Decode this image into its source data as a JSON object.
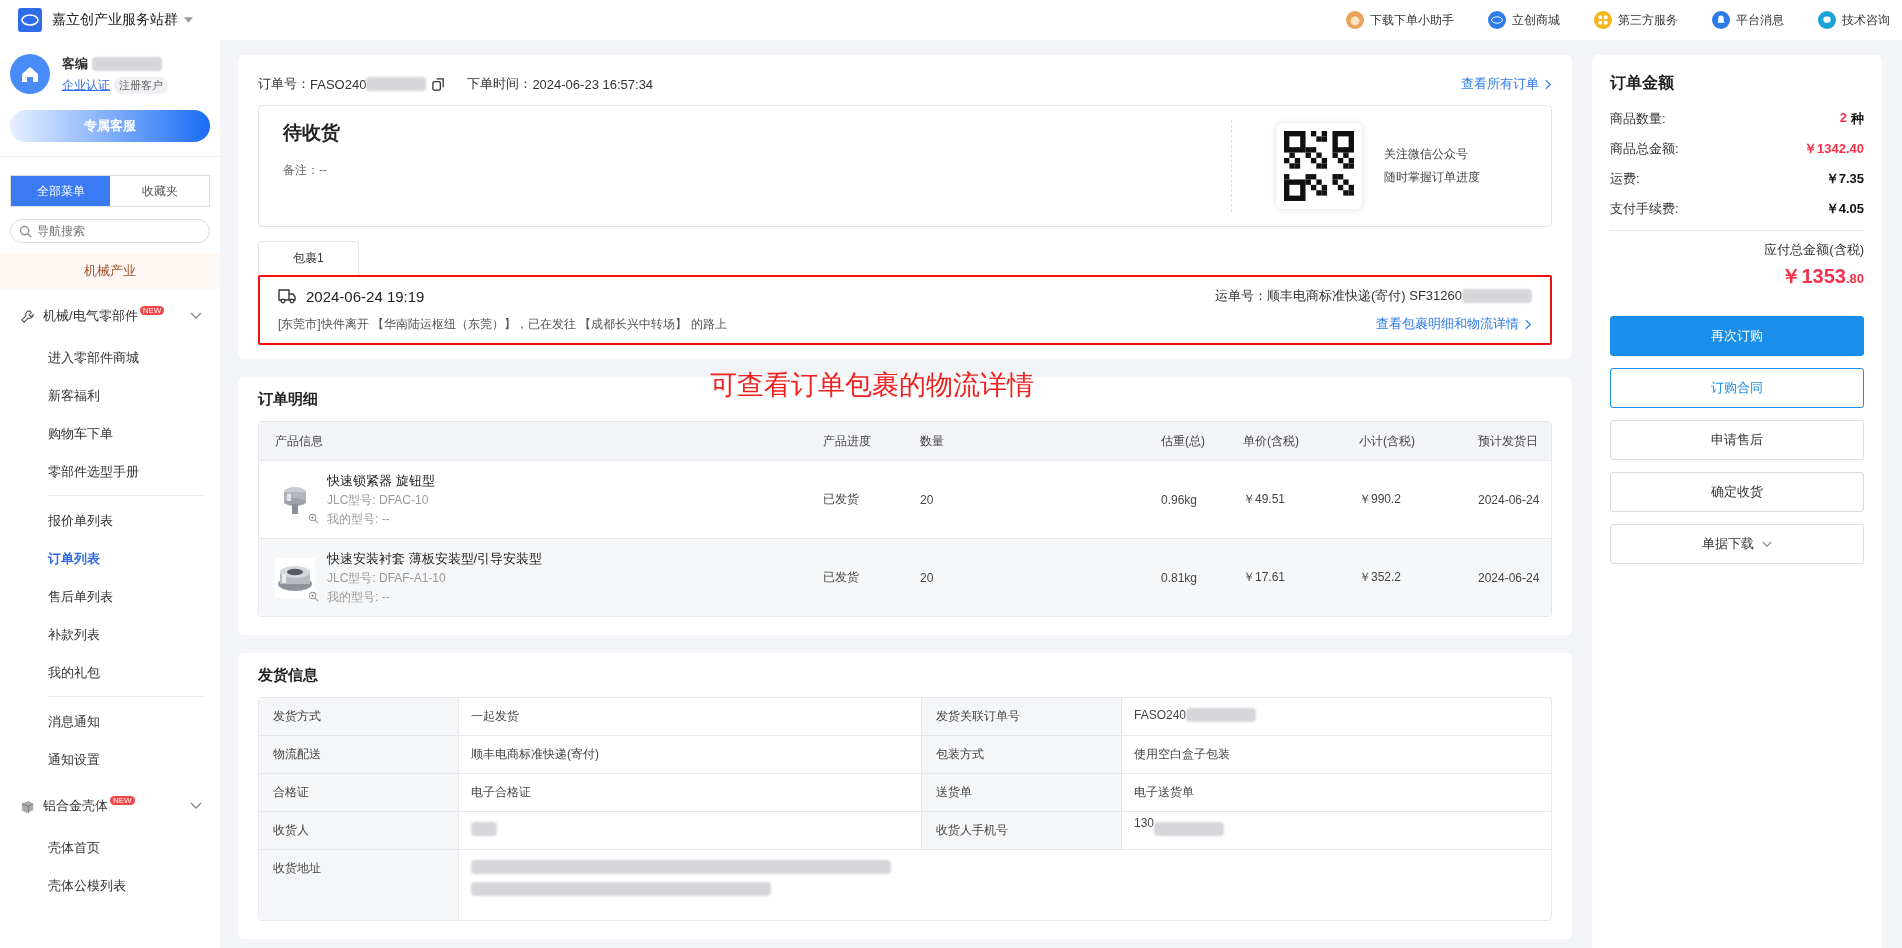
{
  "header": {
    "site_title": "嘉立创产业服务站群",
    "links": [
      {
        "label": "下载下单小助手"
      },
      {
        "label": "立创商城"
      },
      {
        "label": "第三方服务"
      },
      {
        "label": "平台消息"
      },
      {
        "label": "技术咨询"
      }
    ]
  },
  "sidebar": {
    "user": {
      "customer_label": "客编",
      "verify_link": "企业认证",
      "tag": "注册客户"
    },
    "service_button": "专属客服",
    "menu_tabs": [
      {
        "label": "全部菜单",
        "selected": true
      },
      {
        "label": "收藏夹",
        "selected": false
      }
    ],
    "search": {
      "placeholder": "导航搜索"
    },
    "industry": "机械产业",
    "groups": [
      {
        "label": "机械/电气零部件",
        "badge": "NEW",
        "expanded": true,
        "sections": [
          [
            {
              "label": "进入零部件商城",
              "selected": false
            },
            {
              "label": "新客福利",
              "selected": false
            },
            {
              "label": "购物车下单",
              "selected": false
            },
            {
              "label": "零部件选型手册",
              "selected": false
            }
          ],
          [
            {
              "label": "报价单列表",
              "selected": false
            },
            {
              "label": "订单列表",
              "selected": true
            },
            {
              "label": "售后单列表",
              "selected": false
            },
            {
              "label": "补款列表",
              "selected": false
            },
            {
              "label": "我的礼包",
              "selected": false
            }
          ],
          [
            {
              "label": "消息通知",
              "selected": false
            },
            {
              "label": "通知设置",
              "selected": false
            }
          ]
        ]
      },
      {
        "label": "铝合金壳体",
        "badge": "NEW",
        "expanded": true,
        "sections": [
          [
            {
              "label": "壳体首页",
              "selected": false
            },
            {
              "label": "壳体公模列表",
              "selected": false
            }
          ]
        ]
      }
    ]
  },
  "order": {
    "number_label": "订单号：",
    "number": "FASO240",
    "time_label": "下单时间：",
    "time": "2024-06-23 16:57:34",
    "all_orders_link": "查看所有订单",
    "status": "待收货",
    "remark_label": "备注：",
    "remark": "--",
    "wechat_note": [
      "关注微信公众号",
      "随时掌握订单进度"
    ],
    "packages": [
      {
        "label": "包裹1",
        "selected": true
      }
    ],
    "tracking": {
      "time": "2024-06-24 19:19",
      "waybill_label": "运单号：",
      "waybill": "顺丰电商标准快递(寄付) SF31260",
      "message": "[东莞市]快件离开 【华南陆运枢纽（东莞）】，已在发往 【成都长兴中转场】 的路上",
      "detail_link": "查看包裹明细和物流详情"
    }
  },
  "annotation": "可查看订单包裹的物流详情",
  "order_details": {
    "title": "订单明细",
    "columns": [
      "产品信息",
      "产品进度",
      "数量",
      "估重(总)",
      "单价(含税)",
      "小计(含税)",
      "预计发货日"
    ],
    "rows": [
      {
        "name": "快速锁紧器 旋钮型",
        "jlc_model": "JLC型号: DFAC-10",
        "my_model": "我的型号: --",
        "progress": "已发货",
        "quantity": "20",
        "weight": "0.96kg",
        "unit_price": "￥49.51",
        "subtotal": "￥990.2",
        "ship_date": "2024-06-24"
      },
      {
        "name": "快速安装衬套 薄板安装型/引导安装型",
        "jlc_model": "JLC型号: DFAF-A1-10",
        "my_model": "我的型号: --",
        "progress": "已发货",
        "quantity": "20",
        "weight": "0.81kg",
        "unit_price": "￥17.61",
        "subtotal": "￥352.2",
        "ship_date": "2024-06-24"
      }
    ]
  },
  "shipping": {
    "title": "发货信息",
    "rows": [
      {
        "cells": [
          {
            "label": "发货方式",
            "value": "一起发货",
            "redacted": false
          },
          {
            "label": "发货关联订单号",
            "value": "FASO240",
            "redacted": true
          }
        ]
      },
      {
        "cells": [
          {
            "label": "物流配送",
            "value": "顺丰电商标准快递(寄付)",
            "redacted": false
          },
          {
            "label": "包装方式",
            "value": "使用空白盒子包装",
            "redacted": false
          }
        ]
      },
      {
        "cells": [
          {
            "label": "合格证",
            "value": "电子合格证",
            "redacted": false
          },
          {
            "label": "送货单",
            "value": "电子送货单",
            "redacted": false
          }
        ]
      },
      {
        "cells": [
          {
            "label": "收货人",
            "redacted": true
          },
          {
            "label": "收货人手机号",
            "value": "130",
            "redacted": true
          }
        ]
      },
      {
        "cells": [
          {
            "label": "收货地址",
            "redacted": true
          }
        ]
      }
    ]
  },
  "summary": {
    "title": "订单金额",
    "lines": [
      {
        "label": "商品数量:",
        "value": "2",
        "unit": "种",
        "highlight": true
      },
      {
        "label": "商品总金额:",
        "value": "￥1342.40",
        "highlight": true
      },
      {
        "label": "运费:",
        "value": "￥7.35",
        "highlight": false
      },
      {
        "label": "支付手续费:",
        "value": "￥4.05",
        "highlight": false
      }
    ],
    "total_label": "应付总金额(含税)",
    "total_main": "￥1353",
    "total_decimal": ".80",
    "buttons": [
      {
        "label": "再次订购",
        "kind": "primary"
      },
      {
        "label": "订购合同",
        "kind": "outline"
      },
      {
        "label": "申请售后",
        "kind": "plain"
      },
      {
        "label": "确定收货",
        "kind": "plain"
      },
      {
        "label": "单据下载",
        "kind": "dropdown"
      }
    ]
  }
}
